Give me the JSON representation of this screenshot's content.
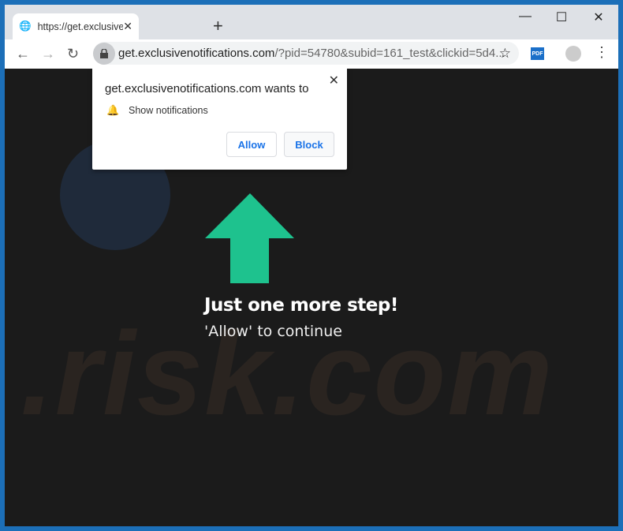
{
  "tab": {
    "title": "https://get.exclusivenotifications.com",
    "icon": "globe-icon"
  },
  "address": {
    "host": "get.exclusivenotifications.com",
    "rest": "/?pid=54780&subid=161_test&clickid=5d4..."
  },
  "extension": {
    "label": "PDF"
  },
  "popup": {
    "heading": "get.exclusivenotifications.com wants to",
    "permission": "Show notifications",
    "allow": "Allow",
    "block": "Block"
  },
  "page": {
    "title": "Just one more step!",
    "subtitle": "'Allow' to continue",
    "arrow_color": "#1ec28e"
  },
  "watermark": "risk.com"
}
